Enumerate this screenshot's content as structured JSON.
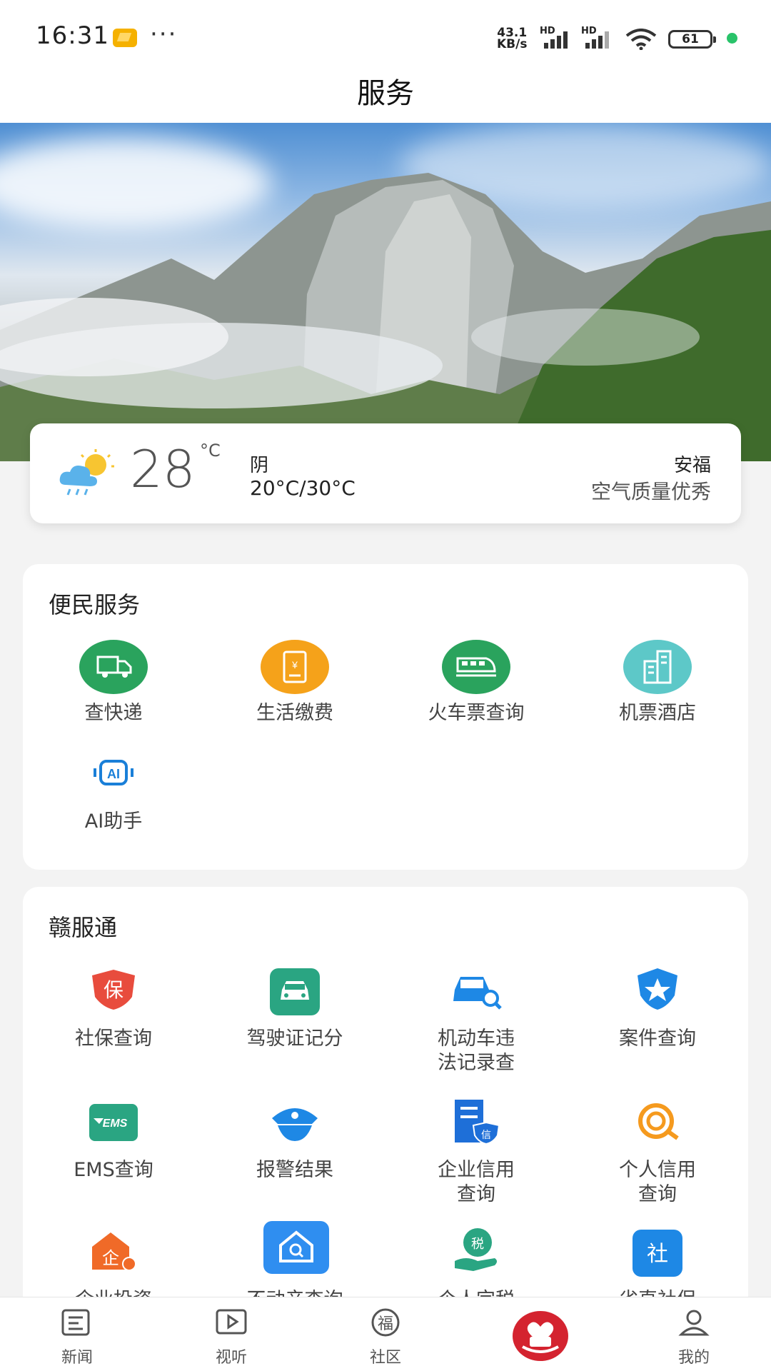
{
  "status_bar": {
    "time": "16:31",
    "more": "···",
    "net_speed_value": "43.1",
    "net_speed_unit": "KB/s",
    "hd1": "HD",
    "hd2": "HD",
    "battery": "61"
  },
  "header": {
    "title": "服务"
  },
  "weather": {
    "temperature": "28",
    "unit": "°C",
    "condition": "阴",
    "range": "20°C/30°C",
    "city": "安福",
    "air_quality": "空气质量优秀",
    "icon": "partly-cloudy-rain-icon"
  },
  "convenience": {
    "title": "便民服务",
    "items": [
      {
        "label": "查快递",
        "icon": "delivery-truck-icon",
        "color": "#2aa35d"
      },
      {
        "label": "生活缴费",
        "icon": "bill-payment-icon",
        "color": "#f5a21a"
      },
      {
        "label": "火车票查询",
        "icon": "train-icon",
        "color": "#2aa35d"
      },
      {
        "label": "机票酒店",
        "icon": "building-icon",
        "color": "#5dc8c8"
      },
      {
        "label": "AI助手",
        "icon": "ai-icon",
        "color": "#1a7fd8"
      }
    ]
  },
  "ganfutong": {
    "title": "赣服通",
    "items": [
      {
        "label": "社保查询",
        "icon": "social-security-shield-icon",
        "color": "#e84c3d"
      },
      {
        "label": "驾驶证记分",
        "icon": "car-license-icon",
        "color": "#2aa582"
      },
      {
        "label": "机动车违\n法记录查",
        "icon": "car-search-icon",
        "color": "#1e88e5"
      },
      {
        "label": "案件查询",
        "icon": "police-star-shield-icon",
        "color": "#1e88e5"
      },
      {
        "label": "EMS查询",
        "icon": "ems-icon",
        "color": "#2aa582"
      },
      {
        "label": "报警结果",
        "icon": "police-hat-icon",
        "color": "#1e88e5"
      },
      {
        "label": "企业信用\n查询",
        "icon": "enterprise-credit-icon",
        "color": "#1e6fd8"
      },
      {
        "label": "个人信用\n查询",
        "icon": "personal-credit-icon",
        "color": "#f59a1e"
      },
      {
        "label": "企业投资",
        "icon": "enterprise-investment-icon",
        "color": "#f06a28"
      },
      {
        "label": "不动产查询",
        "icon": "house-search-icon",
        "color": "#2f8ef0"
      },
      {
        "label": "个人完税",
        "icon": "tax-hand-icon",
        "color": "#2aa582"
      },
      {
        "label": "省直社保",
        "icon": "social-badge-icon",
        "color": "#1e88e5"
      }
    ]
  },
  "bottom_nav": {
    "items": [
      {
        "label": "新闻",
        "icon": "news-icon"
      },
      {
        "label": "视听",
        "icon": "video-play-icon"
      },
      {
        "label": "社区",
        "icon": "fu-community-icon"
      },
      {
        "label": "",
        "icon": "service-heart-icon"
      },
      {
        "label": "我的",
        "icon": "profile-icon"
      }
    ]
  }
}
